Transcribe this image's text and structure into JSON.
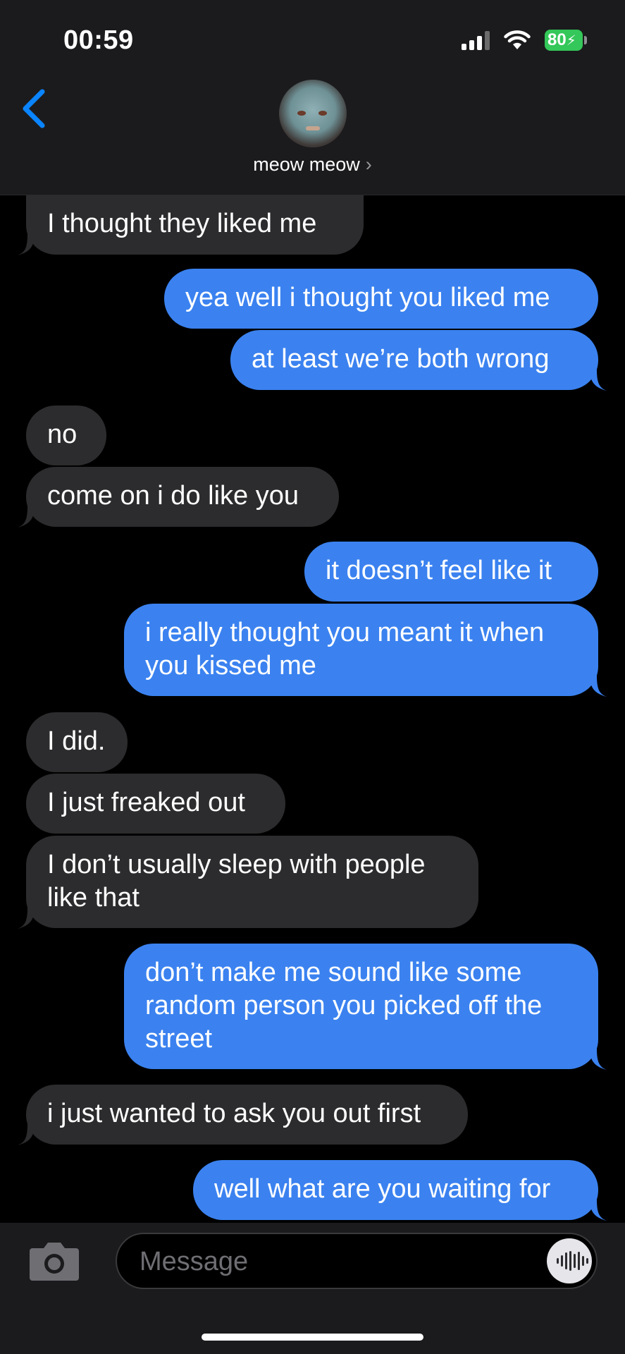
{
  "status_bar": {
    "time": "00:59",
    "battery": "80"
  },
  "contact": {
    "name": "meow meow"
  },
  "messages": [
    {
      "direction": "in",
      "text": "I thought they liked me"
    },
    {
      "direction": "out",
      "text": "yea well i thought you liked me"
    },
    {
      "direction": "out",
      "text": "at least we’re both wrong"
    },
    {
      "direction": "in",
      "text": "no"
    },
    {
      "direction": "in",
      "text": "come on i do like you"
    },
    {
      "direction": "out",
      "text": "it doesn’t feel like it"
    },
    {
      "direction": "out",
      "text": "i really thought you meant it when you kissed me"
    },
    {
      "direction": "in",
      "text": "I did."
    },
    {
      "direction": "in",
      "text": "I just freaked out"
    },
    {
      "direction": "in",
      "text": "I don’t usually sleep with people like that"
    },
    {
      "direction": "out",
      "text": "don’t make me sound like some random person you picked off the street"
    },
    {
      "direction": "in",
      "text": "i just wanted to ask you out first"
    },
    {
      "direction": "out",
      "text": "well what are you waiting for"
    }
  ],
  "composer": {
    "placeholder": "Message"
  },
  "colors": {
    "incoming_bubble": "#2c2c2e",
    "outgoing_bubble": "#3b82f0",
    "accent": "#0a84ff",
    "battery": "#34c759"
  }
}
